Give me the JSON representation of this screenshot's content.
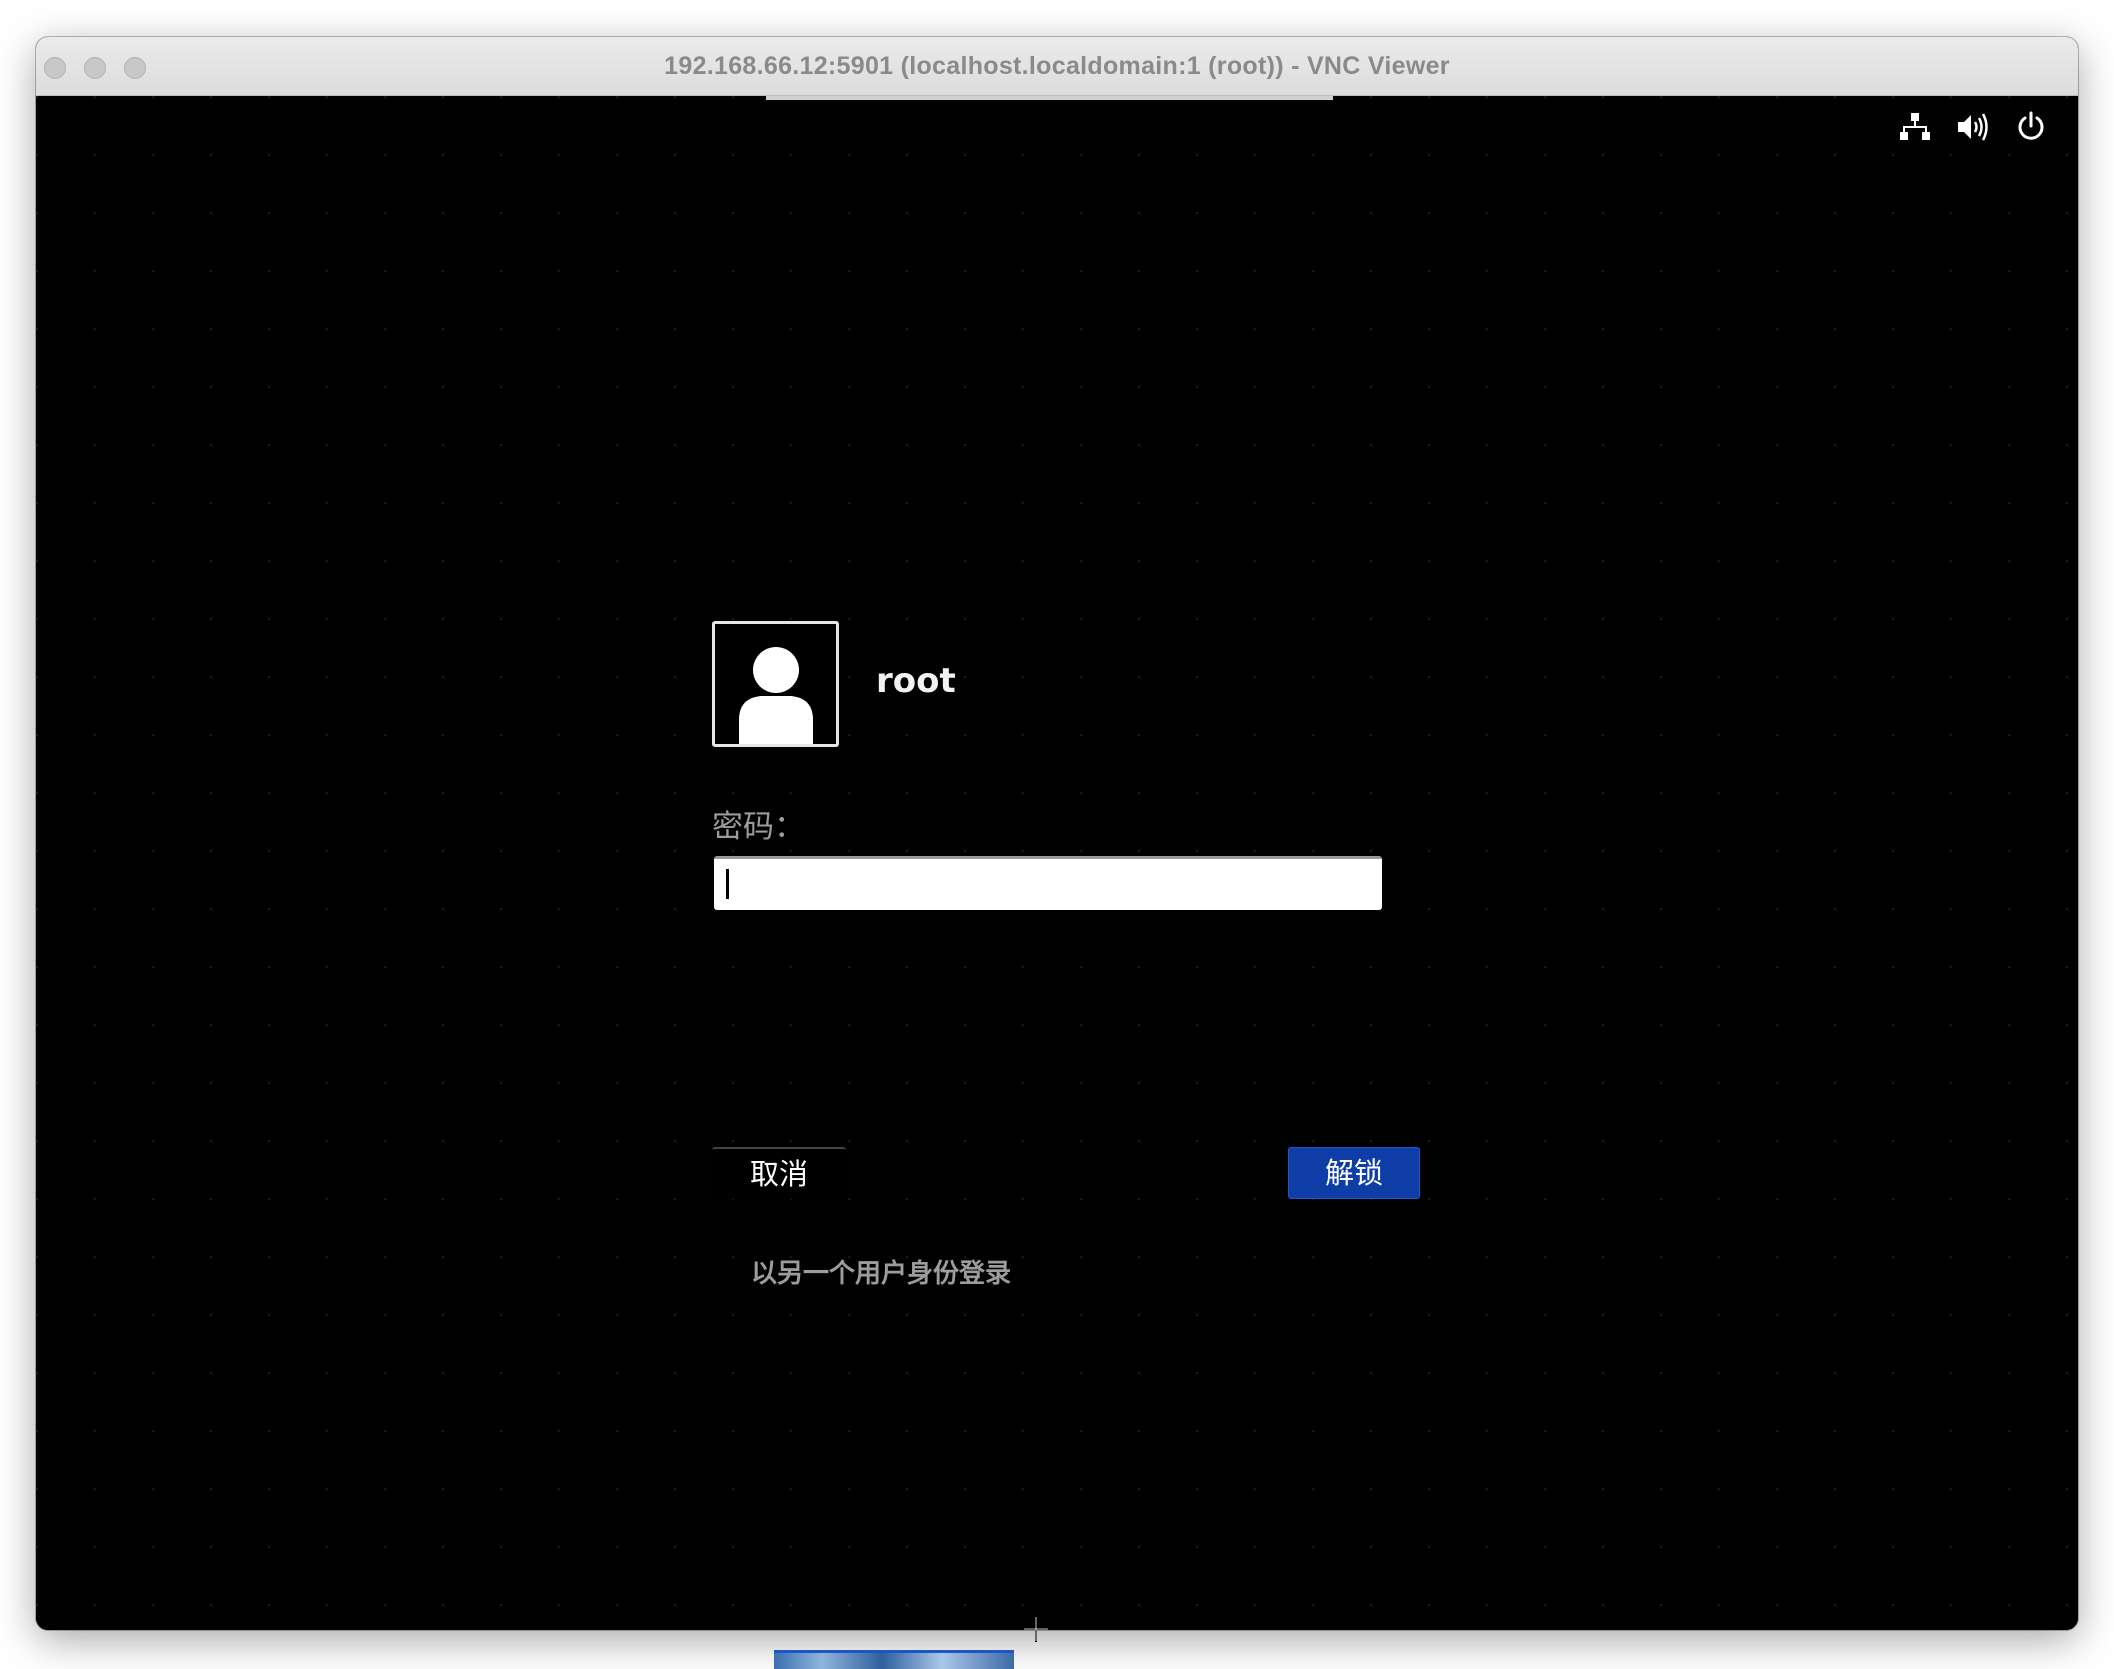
{
  "window": {
    "title": "192.168.66.12:5901 (localhost.localdomain:1 (root)) - VNC Viewer"
  },
  "top_icons": [
    "network-icon",
    "volume-icon",
    "power-icon"
  ],
  "login": {
    "username": "root",
    "password_label": "密码：",
    "password_value": "",
    "cancel_label": "取消",
    "unlock_label": "解锁",
    "other_user_link": "以另一个用户身份登录"
  },
  "colors": {
    "unlock_button": "#0f3da8",
    "background": "#010101"
  }
}
